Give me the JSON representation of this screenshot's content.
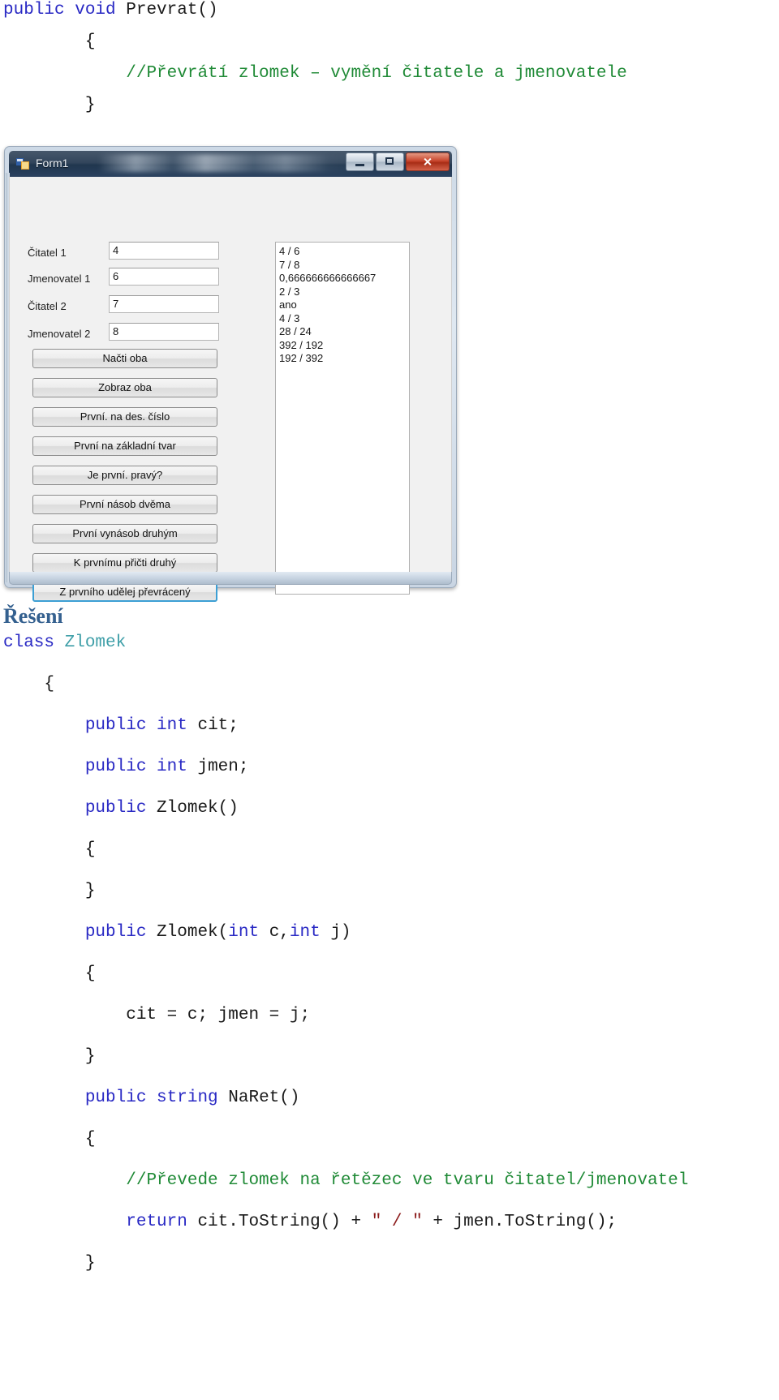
{
  "top_code": {
    "lines": [
      [
        {
          "t": "public ",
          "c": "kw"
        },
        {
          "t": "void ",
          "c": "kw"
        },
        {
          "t": "Prevrat()",
          "c": ""
        }
      ],
      [
        {
          "t": "        {",
          "c": ""
        }
      ],
      [
        {
          "t": "            ",
          "c": ""
        },
        {
          "t": "//Převrátí zlomek – vymění čitatele a jmenovatele",
          "c": "cmt"
        }
      ],
      [
        {
          "t": "        }",
          "c": ""
        }
      ]
    ]
  },
  "winform": {
    "title": "Form1",
    "icon_name": "vs-form-icon",
    "buttons": {
      "minimize_label": "",
      "maximize_label": "",
      "close_label": "✕"
    },
    "fields": [
      {
        "label": "Čitatel 1",
        "value": "4"
      },
      {
        "label": "Jmenovatel 1",
        "value": "6"
      },
      {
        "label": "Čitatel 2",
        "value": "7"
      },
      {
        "label": "Jmenovatel 2",
        "value": "8"
      }
    ],
    "action_buttons": [
      {
        "label": "Načti oba",
        "focused": false
      },
      {
        "label": "Zobraz oba",
        "focused": false
      },
      {
        "label": "První. na des. číslo",
        "focused": false
      },
      {
        "label": "První na základní tvar",
        "focused": false
      },
      {
        "label": "Je první. pravý?",
        "focused": false
      },
      {
        "label": "První násob dvěma",
        "focused": false
      },
      {
        "label": "První vynásob druhým",
        "focused": false
      },
      {
        "label": "K prvnímu přičti druhý",
        "focused": false
      },
      {
        "label": "Z prvního udělej převrácený",
        "focused": true
      }
    ],
    "listbox_items": [
      "4 / 6",
      "7 / 8",
      "0,666666666666667",
      "2 / 3",
      "ano",
      "4 / 3",
      "28 / 24",
      "392 / 192",
      "192 / 392"
    ]
  },
  "solution": {
    "heading": "Řešení",
    "lines": [
      [
        {
          "t": "class ",
          "c": "kw"
        },
        {
          "t": "Zlomek",
          "c": "type"
        }
      ],
      [
        {
          "t": "    {",
          "c": ""
        }
      ],
      [
        {
          "t": "        ",
          "c": ""
        },
        {
          "t": "public ",
          "c": "kw"
        },
        {
          "t": "int ",
          "c": "kw"
        },
        {
          "t": "cit;",
          "c": ""
        }
      ],
      [
        {
          "t": "        ",
          "c": ""
        },
        {
          "t": "public ",
          "c": "kw"
        },
        {
          "t": "int ",
          "c": "kw"
        },
        {
          "t": "jmen;",
          "c": ""
        }
      ],
      [
        {
          "t": "        ",
          "c": ""
        },
        {
          "t": "public ",
          "c": "kw"
        },
        {
          "t": "Zlomek()",
          "c": ""
        }
      ],
      [
        {
          "t": "        {",
          "c": ""
        }
      ],
      [
        {
          "t": "        }",
          "c": ""
        }
      ],
      [
        {
          "t": "        ",
          "c": ""
        },
        {
          "t": "public ",
          "c": "kw"
        },
        {
          "t": "Zlomek(",
          "c": ""
        },
        {
          "t": "int ",
          "c": "kw"
        },
        {
          "t": "c,",
          "c": ""
        },
        {
          "t": "int ",
          "c": "kw"
        },
        {
          "t": "j)",
          "c": ""
        }
      ],
      [
        {
          "t": "        {",
          "c": ""
        }
      ],
      [
        {
          "t": "            cit = c; jmen = j;",
          "c": ""
        }
      ],
      [
        {
          "t": "        }",
          "c": ""
        }
      ],
      [
        {
          "t": "        ",
          "c": ""
        },
        {
          "t": "public ",
          "c": "kw"
        },
        {
          "t": "string ",
          "c": "kw"
        },
        {
          "t": "NaRet()",
          "c": ""
        }
      ],
      [
        {
          "t": "        {",
          "c": ""
        }
      ],
      [
        {
          "t": "            ",
          "c": ""
        },
        {
          "t": "//Převede zlomek na řetězec ve tvaru čitatel/jmenovatel",
          "c": "cmt"
        }
      ],
      [
        {
          "t": "            ",
          "c": ""
        },
        {
          "t": "return ",
          "c": "kw"
        },
        {
          "t": "cit.ToString() + ",
          "c": ""
        },
        {
          "t": "\" / \"",
          "c": "str"
        },
        {
          "t": " + jmen.ToString();",
          "c": ""
        }
      ],
      [
        {
          "t": "        }",
          "c": ""
        }
      ]
    ]
  }
}
